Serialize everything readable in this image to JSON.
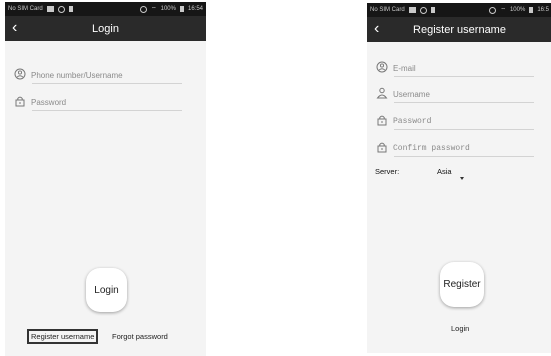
{
  "login": {
    "statusbar": {
      "carrier": "No SIM Card",
      "battery": "100%",
      "time": "16:54"
    },
    "title": "Login",
    "fields": {
      "username_placeholder": "Phone number/Username",
      "password_placeholder": "Password"
    },
    "login_button": "Login",
    "register_link": "Register username",
    "forgot_link": "Forgot password"
  },
  "register": {
    "statusbar": {
      "carrier": "No SIM Card",
      "battery": "100%",
      "time": "16:5"
    },
    "title": "Register username",
    "fields": {
      "email_placeholder": "E-mail",
      "username_placeholder": "Username",
      "password_placeholder": "Password",
      "confirm_placeholder": "Confirm password"
    },
    "server_label": "Server:",
    "server_value": "Asia",
    "register_button": "Register",
    "login_link": "Login"
  },
  "icons": {
    "back": "chevron-left-icon",
    "user": "user-circle-icon",
    "lock": "lock-icon",
    "person": "person-icon",
    "dropdown": "triangle-down-icon"
  },
  "colors": {
    "titlebar": "#2a2a2a",
    "statusbar": "#161616",
    "screen_bg": "#f4f4f4",
    "input_line": "#d3d3d3"
  }
}
